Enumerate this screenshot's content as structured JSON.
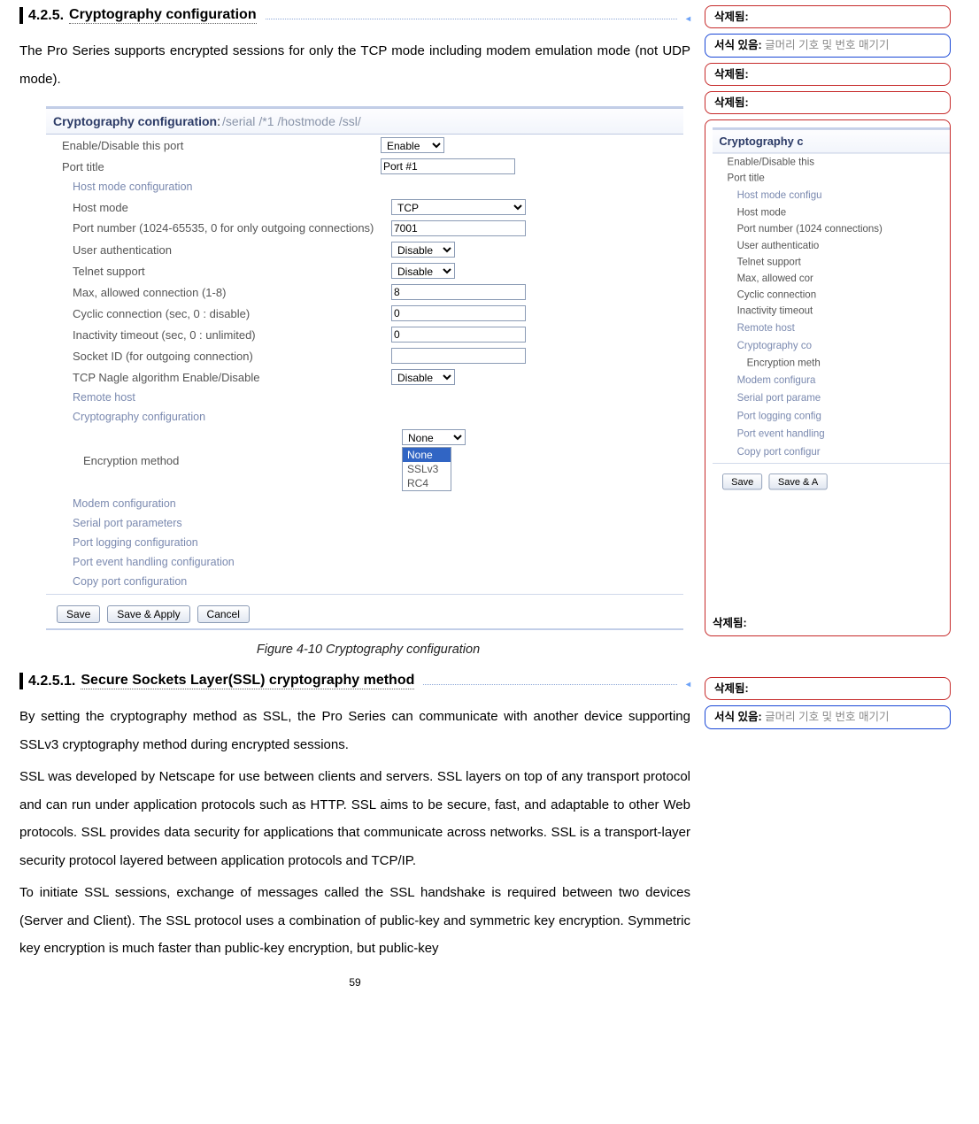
{
  "headings": {
    "sec425_num": "4.2.5.",
    "sec425_title": "Cryptography configuration",
    "sec4251_num": "4.2.5.1.",
    "sec4251_title": "Secure Sockets Layer(SSL) cryptography method"
  },
  "paragraphs": {
    "p1": "The Pro Series supports encrypted sessions for only the TCP mode including modem emulation mode (not UDP mode).",
    "p2": "By setting the cryptography method as SSL, the Pro Series can communicate with another device supporting SSLv3 cryptography method during encrypted sessions.",
    "p3": "SSL was developed by Netscape for use between clients and servers. SSL layers on top of any transport protocol and can run under application protocols such as HTTP. SSL aims to be secure, fast, and adaptable to other Web protocols. SSL provides data security for applications that communicate across networks. SSL is a transport-layer security protocol layered between application protocols and TCP/IP.",
    "p4": "To initiate SSL sessions, exchange of messages called the SSL handshake is required between two devices (Server and Client). The SSL protocol uses a combination of public-key and symmetric key encryption. Symmetric key encryption is much faster than public-key encryption, but public-key"
  },
  "figure": {
    "caption": "Figure 4-10 Cryptography configuration",
    "title": "Cryptography configuration",
    "breadcrumb_sep": " :",
    "crumbs": [
      "/serial",
      "/*1",
      "/hostmode",
      "/ssl/"
    ],
    "rows": {
      "enable_label": "Enable/Disable this port",
      "enable_value": "Enable",
      "porttitle_label": "Port title",
      "porttitle_value": "Port #1",
      "hostmodecfg": "Host mode configuration",
      "hostmode_label": "Host mode",
      "hostmode_value": "TCP",
      "portnum_label": "Port number (1024-65535, 0 for only outgoing connections)",
      "portnum_value": "7001",
      "userauth_label": "User authentication",
      "userauth_value": "Disable",
      "telnet_label": "Telnet support",
      "telnet_value": "Disable",
      "maxconn_label": "Max, allowed connection (1-8)",
      "maxconn_value": "8",
      "cyclic_label": "Cyclic connection (sec, 0 : disable)",
      "cyclic_value": "0",
      "inact_label": "Inactivity timeout (sec, 0 : unlimited)",
      "inact_value": "0",
      "sockid_label": "Socket ID (for outgoing connection)",
      "sockid_value": "",
      "nagle_label": "TCP Nagle algorithm Enable/Disable",
      "nagle_value": "Disable",
      "remotehost": "Remote host",
      "cryptocfg": "Cryptography configuration",
      "encmethod_label": "Encryption method",
      "encmethod_value": "None",
      "enc_options": [
        "None",
        "SSLv3",
        "RC4"
      ],
      "modemcfg": "Modem configuration",
      "serialparams": "Serial port parameters",
      "portlog": "Port logging configuration",
      "portevent": "Port event handling configuration",
      "copyport": "Copy port configuration"
    },
    "buttons": {
      "save": "Save",
      "saveapply": "Save & Apply",
      "cancel": "Cancel"
    }
  },
  "comments": {
    "deleted": "삭제됨:",
    "format_label": "서식 있음:",
    "format_text": "글머리 기호 및 번호 매기기"
  },
  "thumb": {
    "title": "Cryptography c",
    "rows": [
      "Enable/Disable this",
      "Port title",
      "Host mode configu",
      "Host mode",
      "Port number (1024 connections)",
      "User authenticatio",
      "Telnet support",
      "Max, allowed cor",
      "Cyclic connection",
      "Inactivity timeout",
      "Remote host",
      "Cryptography co",
      "Encryption meth",
      "Modem configura",
      "Serial port parame",
      "Port logging config",
      "Port event handling",
      "Copy port configur"
    ],
    "save": "Save",
    "saveapply": "Save & A"
  },
  "page_number": "59"
}
